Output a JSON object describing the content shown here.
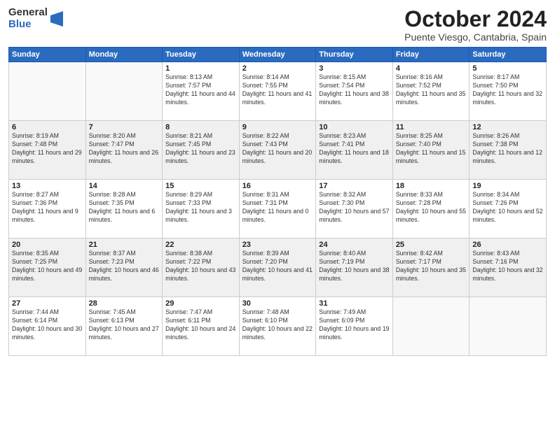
{
  "logo": {
    "general": "General",
    "blue": "Blue"
  },
  "header": {
    "month": "October 2024",
    "location": "Puente Viesgo, Cantabria, Spain"
  },
  "weekdays": [
    "Sunday",
    "Monday",
    "Tuesday",
    "Wednesday",
    "Thursday",
    "Friday",
    "Saturday"
  ],
  "weeks": [
    [
      {
        "day": "",
        "info": ""
      },
      {
        "day": "",
        "info": ""
      },
      {
        "day": "1",
        "info": "Sunrise: 8:13 AM\nSunset: 7:57 PM\nDaylight: 11 hours and 44 minutes."
      },
      {
        "day": "2",
        "info": "Sunrise: 8:14 AM\nSunset: 7:55 PM\nDaylight: 11 hours and 41 minutes."
      },
      {
        "day": "3",
        "info": "Sunrise: 8:15 AM\nSunset: 7:54 PM\nDaylight: 11 hours and 38 minutes."
      },
      {
        "day": "4",
        "info": "Sunrise: 8:16 AM\nSunset: 7:52 PM\nDaylight: 11 hours and 35 minutes."
      },
      {
        "day": "5",
        "info": "Sunrise: 8:17 AM\nSunset: 7:50 PM\nDaylight: 11 hours and 32 minutes."
      }
    ],
    [
      {
        "day": "6",
        "info": "Sunrise: 8:19 AM\nSunset: 7:48 PM\nDaylight: 11 hours and 29 minutes."
      },
      {
        "day": "7",
        "info": "Sunrise: 8:20 AM\nSunset: 7:47 PM\nDaylight: 11 hours and 26 minutes."
      },
      {
        "day": "8",
        "info": "Sunrise: 8:21 AM\nSunset: 7:45 PM\nDaylight: 11 hours and 23 minutes."
      },
      {
        "day": "9",
        "info": "Sunrise: 8:22 AM\nSunset: 7:43 PM\nDaylight: 11 hours and 20 minutes."
      },
      {
        "day": "10",
        "info": "Sunrise: 8:23 AM\nSunset: 7:41 PM\nDaylight: 11 hours and 18 minutes."
      },
      {
        "day": "11",
        "info": "Sunrise: 8:25 AM\nSunset: 7:40 PM\nDaylight: 11 hours and 15 minutes."
      },
      {
        "day": "12",
        "info": "Sunrise: 8:26 AM\nSunset: 7:38 PM\nDaylight: 11 hours and 12 minutes."
      }
    ],
    [
      {
        "day": "13",
        "info": "Sunrise: 8:27 AM\nSunset: 7:36 PM\nDaylight: 11 hours and 9 minutes."
      },
      {
        "day": "14",
        "info": "Sunrise: 8:28 AM\nSunset: 7:35 PM\nDaylight: 11 hours and 6 minutes."
      },
      {
        "day": "15",
        "info": "Sunrise: 8:29 AM\nSunset: 7:33 PM\nDaylight: 11 hours and 3 minutes."
      },
      {
        "day": "16",
        "info": "Sunrise: 8:31 AM\nSunset: 7:31 PM\nDaylight: 11 hours and 0 minutes."
      },
      {
        "day": "17",
        "info": "Sunrise: 8:32 AM\nSunset: 7:30 PM\nDaylight: 10 hours and 57 minutes."
      },
      {
        "day": "18",
        "info": "Sunrise: 8:33 AM\nSunset: 7:28 PM\nDaylight: 10 hours and 55 minutes."
      },
      {
        "day": "19",
        "info": "Sunrise: 8:34 AM\nSunset: 7:26 PM\nDaylight: 10 hours and 52 minutes."
      }
    ],
    [
      {
        "day": "20",
        "info": "Sunrise: 8:35 AM\nSunset: 7:25 PM\nDaylight: 10 hours and 49 minutes."
      },
      {
        "day": "21",
        "info": "Sunrise: 8:37 AM\nSunset: 7:23 PM\nDaylight: 10 hours and 46 minutes."
      },
      {
        "day": "22",
        "info": "Sunrise: 8:38 AM\nSunset: 7:22 PM\nDaylight: 10 hours and 43 minutes."
      },
      {
        "day": "23",
        "info": "Sunrise: 8:39 AM\nSunset: 7:20 PM\nDaylight: 10 hours and 41 minutes."
      },
      {
        "day": "24",
        "info": "Sunrise: 8:40 AM\nSunset: 7:19 PM\nDaylight: 10 hours and 38 minutes."
      },
      {
        "day": "25",
        "info": "Sunrise: 8:42 AM\nSunset: 7:17 PM\nDaylight: 10 hours and 35 minutes."
      },
      {
        "day": "26",
        "info": "Sunrise: 8:43 AM\nSunset: 7:16 PM\nDaylight: 10 hours and 32 minutes."
      }
    ],
    [
      {
        "day": "27",
        "info": "Sunrise: 7:44 AM\nSunset: 6:14 PM\nDaylight: 10 hours and 30 minutes."
      },
      {
        "day": "28",
        "info": "Sunrise: 7:45 AM\nSunset: 6:13 PM\nDaylight: 10 hours and 27 minutes."
      },
      {
        "day": "29",
        "info": "Sunrise: 7:47 AM\nSunset: 6:11 PM\nDaylight: 10 hours and 24 minutes."
      },
      {
        "day": "30",
        "info": "Sunrise: 7:48 AM\nSunset: 6:10 PM\nDaylight: 10 hours and 22 minutes."
      },
      {
        "day": "31",
        "info": "Sunrise: 7:49 AM\nSunset: 6:09 PM\nDaylight: 10 hours and 19 minutes."
      },
      {
        "day": "",
        "info": ""
      },
      {
        "day": "",
        "info": ""
      }
    ]
  ]
}
